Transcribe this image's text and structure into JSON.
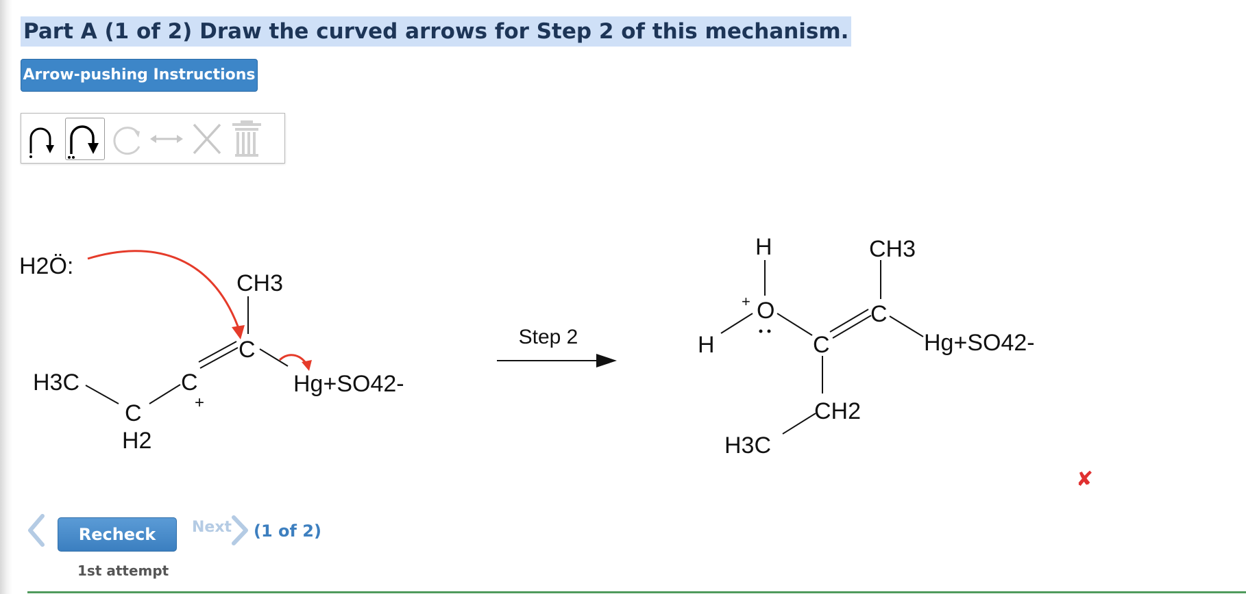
{
  "part_title": "Part A (1 of 2) Draw the curved arrows for Step 2 of this mechanism.",
  "instructions_button": "Arrow-pushing Instructions",
  "toolbar": {
    "tools": [
      "single-electron-arrow-icon",
      "electron-pair-arrow-icon",
      "rotate-icon",
      "resonance-arrow-icon",
      "delete-icon",
      "trash-icon"
    ]
  },
  "mechanism": {
    "step_label": "Step 2",
    "reactant": {
      "nucleophile": "H2Ö:",
      "methyl": "CH3",
      "carbon": "C",
      "cation_carbon": "C",
      "charge": "+",
      "ethyl_ch3": "H3C",
      "ch2_c": "C",
      "ch2_h": "H2",
      "mercury": "Hg+SO42-"
    },
    "product": {
      "h_top": "H",
      "o": "O",
      "o_charge": "+",
      "h_left": "H",
      "c_left": "C",
      "c_right": "C",
      "methyl": "CH3",
      "ch2": "CH2",
      "h3c": "H3C",
      "mercury": "Hg+SO42-"
    }
  },
  "nav": {
    "recheck_label": "Recheck",
    "next_label": "Next",
    "counter": "(1 of 2)",
    "attempt": "1st attempt"
  },
  "status_icon": "close-icon",
  "colors": {
    "accent": "#3d86c8",
    "arrow_red": "#e53b2a",
    "title_highlight": "#cfe0f7",
    "incorrect": "#e03030"
  }
}
